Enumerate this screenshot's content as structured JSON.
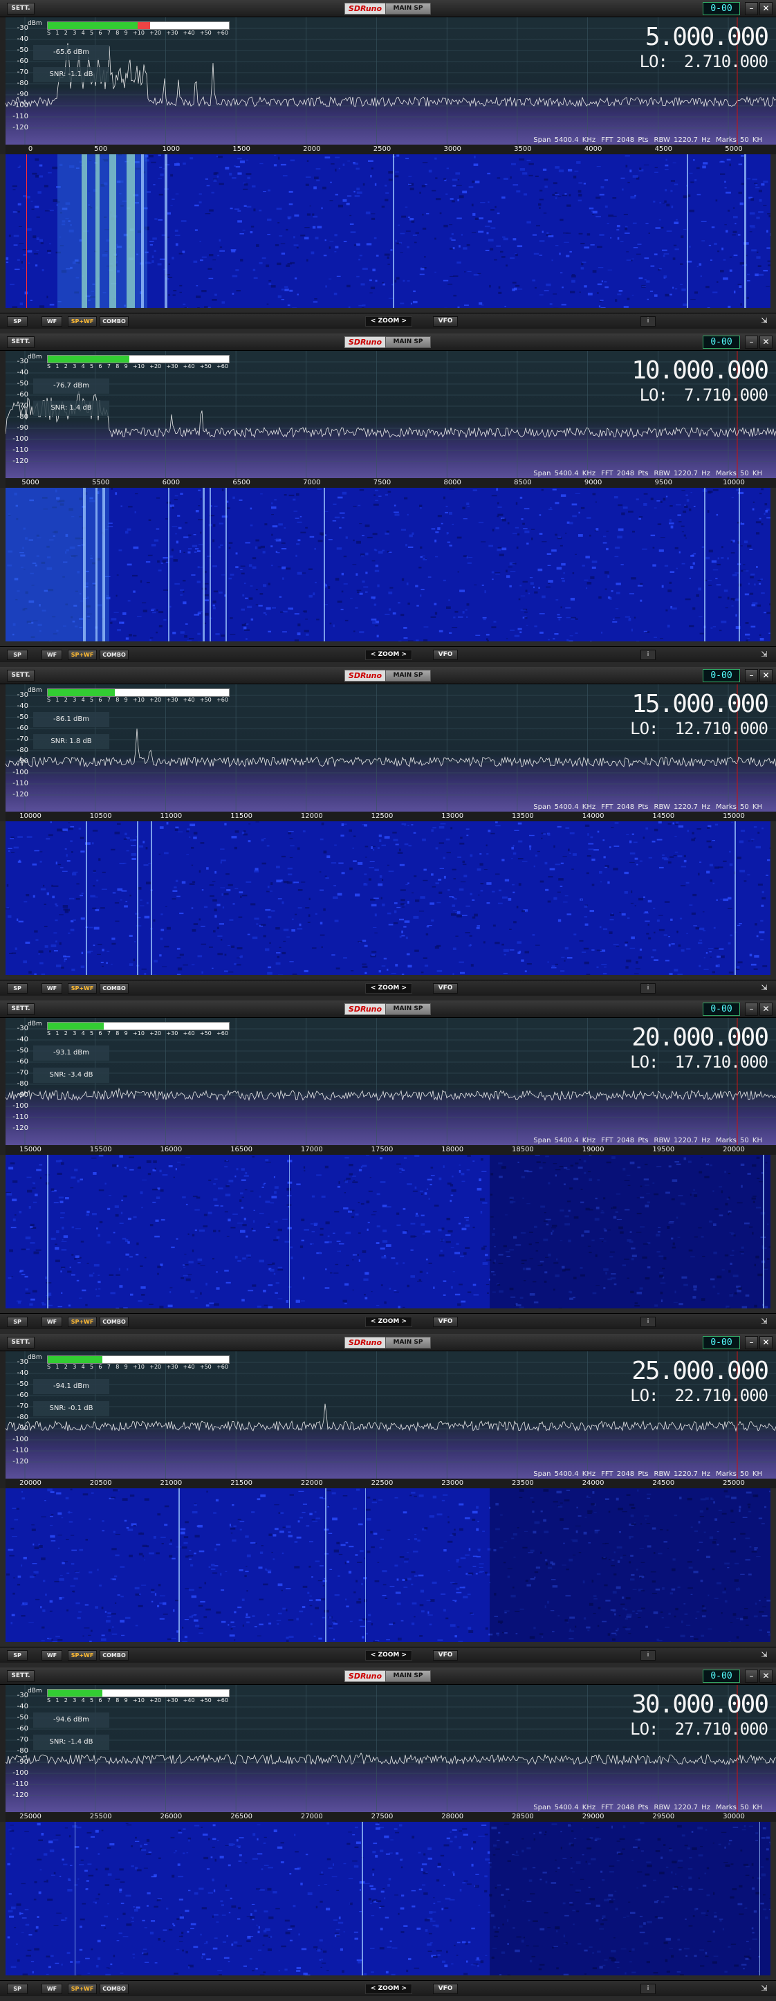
{
  "common": {
    "settings_label": "SETT.",
    "logo_text": "SDRuno",
    "main_sp_label": "MAIN SP",
    "clock": "0-00",
    "minimize_glyph": "–",
    "close_glyph": "✕",
    "dbm_unit": "dBm",
    "y_ticks": [
      "-30",
      "-40",
      "-50",
      "-60",
      "-70",
      "-80",
      "-90",
      "-100",
      "-110",
      "-120"
    ],
    "s_scale": [
      "S",
      "1",
      "2",
      "3",
      "4",
      "5",
      "6",
      "7",
      "8",
      "9",
      "+10",
      "+20",
      "+30",
      "+40",
      "+50",
      "+60"
    ],
    "lo_label": "LO:",
    "span": "Span 5400.4 KHz",
    "fft": "FFT 2048 Pts",
    "rbw": "RBW 1220.7 Hz",
    "marks": "Marks 50 KH",
    "buttons": {
      "sp": "SP",
      "wf": "WF",
      "spwf": "SP+WF",
      "combo": "COMBO",
      "zoom": "ZOOM",
      "zoom_left": "<",
      "zoom_right": ">",
      "vfo": "VFO",
      "info": "i",
      "resize": "⇲"
    },
    "colors": {
      "smeter_green": "#33cc33",
      "smeter_red": "#e44444",
      "waterfall_base": "#0b1aa8",
      "marker_red": "#cc1111"
    }
  },
  "panels": [
    {
      "frequency": "5.000.000",
      "lo": "2.710.000",
      "signal": "-65.6 dBm",
      "snr": "SNR: -1.1 dB",
      "smeter_level": 0.55,
      "x_ticks": [
        "0",
        "500",
        "1000",
        "1500",
        "2000",
        "2500",
        "3000",
        "3500",
        "4000",
        "4500",
        "5000"
      ]
    },
    {
      "frequency": "10.000.000",
      "lo": "7.710.000",
      "signal": "-76.7 dBm",
      "snr": "SNR: 1.4 dB",
      "smeter_level": 0.45,
      "x_ticks": [
        "5000",
        "5500",
        "6000",
        "6500",
        "7000",
        "7500",
        "8000",
        "8500",
        "9000",
        "9500",
        "10000"
      ]
    },
    {
      "frequency": "15.000.000",
      "lo": "12.710.000",
      "signal": "-86.1 dBm",
      "snr": "SNR: 1.8 dB",
      "smeter_level": 0.37,
      "x_ticks": [
        "10000",
        "10500",
        "11000",
        "11500",
        "12000",
        "12500",
        "13000",
        "13500",
        "14000",
        "14500",
        "15000"
      ]
    },
    {
      "frequency": "20.000.000",
      "lo": "17.710.000",
      "signal": "-93.1 dBm",
      "snr": "SNR: -3.4 dB",
      "smeter_level": 0.31,
      "x_ticks": [
        "15000",
        "15500",
        "16000",
        "16500",
        "17000",
        "17500",
        "18000",
        "18500",
        "19000",
        "19500",
        "20000"
      ]
    },
    {
      "frequency": "25.000.000",
      "lo": "22.710.000",
      "signal": "-94.1 dBm",
      "snr": "SNR: -0.1 dB",
      "smeter_level": 0.3,
      "x_ticks": [
        "20000",
        "20500",
        "21000",
        "21500",
        "22000",
        "22500",
        "23000",
        "23500",
        "24000",
        "24500",
        "25000"
      ]
    },
    {
      "frequency": "30.000.000",
      "lo": "27.710.000",
      "signal": "-94.6 dBm",
      "snr": "SNR: -1.4 dB",
      "smeter_level": 0.3,
      "x_ticks": [
        "25000",
        "25500",
        "26000",
        "26500",
        "27000",
        "27500",
        "28000",
        "28500",
        "29000",
        "29500",
        "30000"
      ]
    }
  ]
}
